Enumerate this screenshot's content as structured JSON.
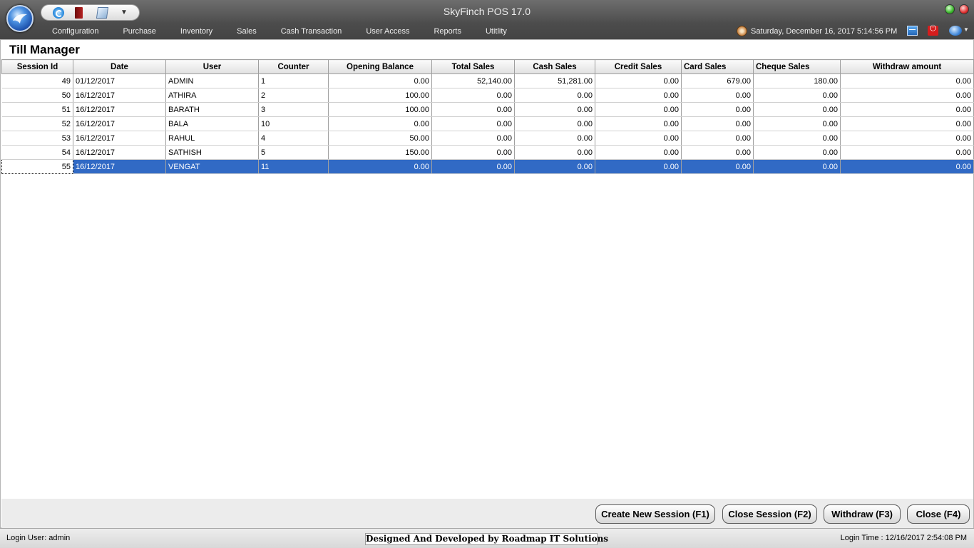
{
  "app": {
    "title": "SkyFinch  POS 17.0"
  },
  "menu": [
    "Configuration",
    "Purchase",
    "Inventory",
    "Sales",
    "Cash Transaction",
    "User Access",
    "Reports",
    "Utitlity"
  ],
  "header": {
    "datetime": "Saturday, December 16, 2017 5:14:56 PM"
  },
  "page": {
    "title": "Till Manager"
  },
  "table": {
    "columns": [
      "Session Id",
      "Date",
      "User",
      "Counter",
      "Opening Balance",
      "Total Sales",
      "Cash Sales",
      "Credit Sales",
      "Card Sales",
      "Cheque Sales",
      "Withdraw amount"
    ],
    "rows": [
      [
        "49",
        "01/12/2017",
        "ADMIN",
        "1",
        "0.00",
        "52,140.00",
        "51,281.00",
        "0.00",
        "679.00",
        "180.00",
        "0.00"
      ],
      [
        "50",
        "16/12/2017",
        "ATHIRA",
        "2",
        "100.00",
        "0.00",
        "0.00",
        "0.00",
        "0.00",
        "0.00",
        "0.00"
      ],
      [
        "51",
        "16/12/2017",
        "BARATH",
        "3",
        "100.00",
        "0.00",
        "0.00",
        "0.00",
        "0.00",
        "0.00",
        "0.00"
      ],
      [
        "52",
        "16/12/2017",
        "BALA",
        "10",
        "0.00",
        "0.00",
        "0.00",
        "0.00",
        "0.00",
        "0.00",
        "0.00"
      ],
      [
        "53",
        "16/12/2017",
        "RAHUL",
        "4",
        "50.00",
        "0.00",
        "0.00",
        "0.00",
        "0.00",
        "0.00",
        "0.00"
      ],
      [
        "54",
        "16/12/2017",
        "SATHISH",
        "5",
        "150.00",
        "0.00",
        "0.00",
        "0.00",
        "0.00",
        "0.00",
        "0.00"
      ],
      [
        "55",
        "16/12/2017",
        "VENGAT",
        "11",
        "0.00",
        "0.00",
        "0.00",
        "0.00",
        "0.00",
        "0.00",
        "0.00"
      ]
    ],
    "selected_row": 6
  },
  "buttons": {
    "create": "Create New Session (F1)",
    "close_session": "Close Session (F2)",
    "withdraw": "Withdraw (F3)",
    "close": "Close (F4)"
  },
  "status": {
    "login_user": "Login User: admin",
    "designed_by": "Designed And Developed by Roadmap IT Solutions",
    "login_time": "Login Time : 12/16/2017 2:54:08 PM"
  },
  "colors": {
    "selection": "#316ac5",
    "titlebar": "#555555"
  }
}
